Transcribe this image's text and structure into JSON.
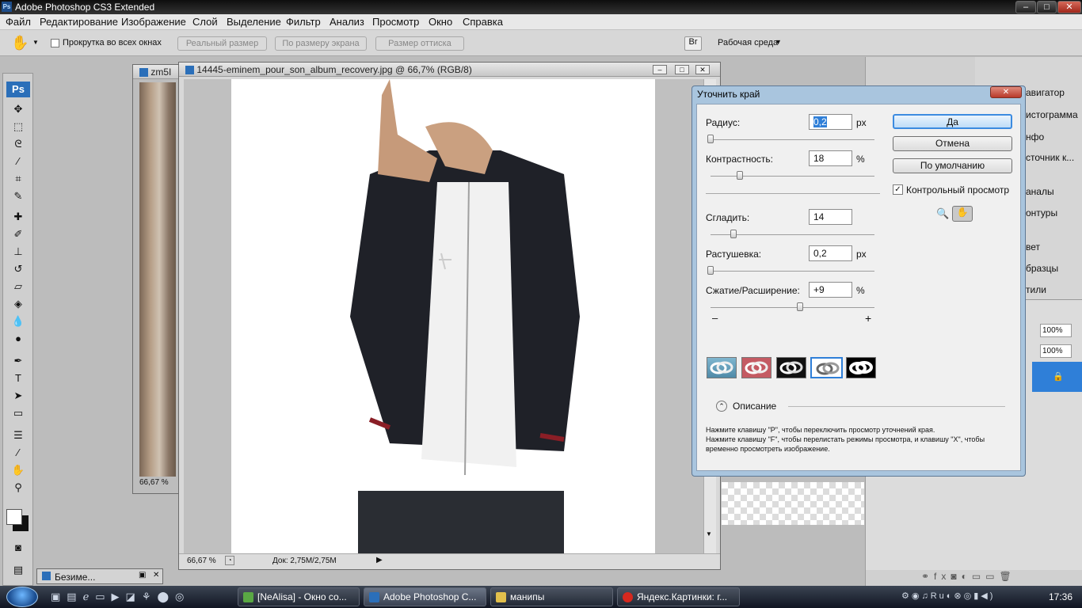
{
  "app_title": "Adobe Photoshop CS3 Extended",
  "menu": [
    "Файл",
    "Редактирование",
    "Изображение",
    "Слой",
    "Выделение",
    "Фильтр",
    "Анализ",
    "Просмотр",
    "Окно",
    "Справка"
  ],
  "options": {
    "scroll_all": "Прокрутка во всех окнах",
    "actual_size": "Реальный размер",
    "fit_screen": "По размеру экрана",
    "print_size": "Размер оттиска",
    "workspace": "Рабочая среда"
  },
  "doc_back": {
    "title": "zm5I",
    "zoom": "66,67 %"
  },
  "doc_main": {
    "title": "14445-eminem_pour_son_album_recovery.jpg @ 66,7% (RGB/8)",
    "zoom": "66,67 %",
    "status": "Док: 2,75M/2,75M"
  },
  "minimized_doc": "Безиме...",
  "dialog": {
    "title": "Уточнить край",
    "fields": [
      {
        "label": "Радиус:",
        "value": "0,2",
        "unit": "px",
        "fraction": 0.0
      },
      {
        "label": "Контрастность:",
        "value": "18",
        "unit": "%",
        "fraction": 0.18
      },
      {
        "label": "Сгладить:",
        "value": "14",
        "unit": "",
        "fraction": 0.14
      },
      {
        "label": "Растушевка:",
        "value": "0,2",
        "unit": "px",
        "fraction": 0.0
      },
      {
        "label": "Сжатие/Расширение:",
        "value": "+9",
        "unit": "%",
        "fraction": 0.545
      }
    ],
    "minus": "–",
    "plus": "+",
    "ok": "Да",
    "cancel": "Отмена",
    "default": "По умолчанию",
    "preview": "Контрольный просмотр",
    "preview_checked": true,
    "description_toggle": "Описание",
    "description": "Нажмите клавишу \"P\", чтобы переключить просмотр уточнений края.\nНажмите клавишу \"F\", чтобы перелистать режимы просмотра, и клавишу \"X\", чтобы временно просмотреть изображение."
  },
  "panels": {
    "navigator": "авигатор",
    "histogram": "истограмма",
    "info": "нфо",
    "source": "сточник к...",
    "channels": "аналы",
    "paths": "онтуры",
    "color": "вет",
    "swatches": "бразцы",
    "styles": "тили",
    "opacity": "100%",
    "fill": "100%"
  },
  "taskbar": {
    "items": [
      "[NeAlisa] - Окно со...",
      "Adobe Photoshop C...",
      "манипы",
      "Яндекс.Картинки: г..."
    ],
    "clock": "17:36"
  },
  "colors": {
    "accent": "#2f7fd8",
    "dialog_frame": "#a9c5de",
    "titlebar": "#1a1a1a"
  }
}
